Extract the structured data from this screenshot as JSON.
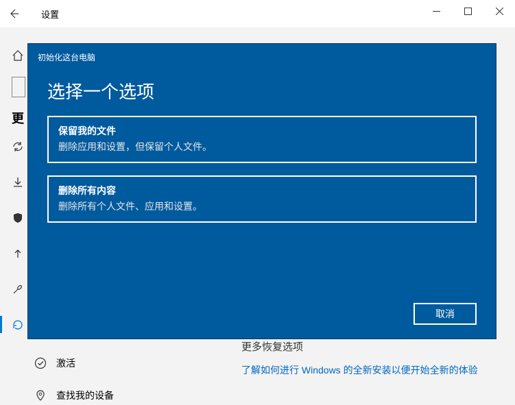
{
  "titlebar": {
    "title": "设置"
  },
  "sidebar": {
    "update_header": "更",
    "items": [
      {
        "label": "激活"
      },
      {
        "label": "查找我的设备"
      }
    ]
  },
  "main": {
    "section_label": "更多恢复选项",
    "link": "了解如何进行 Windows 的全新安装以便开始全新的体验"
  },
  "dialog": {
    "small_title": "初始化这台电脑",
    "heading": "选择一个选项",
    "options": [
      {
        "title": "保留我的文件",
        "desc": "删除应用和设置，但保留个人文件。"
      },
      {
        "title": "删除所有内容",
        "desc": "删除所有个人文件、应用和设置。"
      }
    ],
    "cancel": "取消"
  }
}
